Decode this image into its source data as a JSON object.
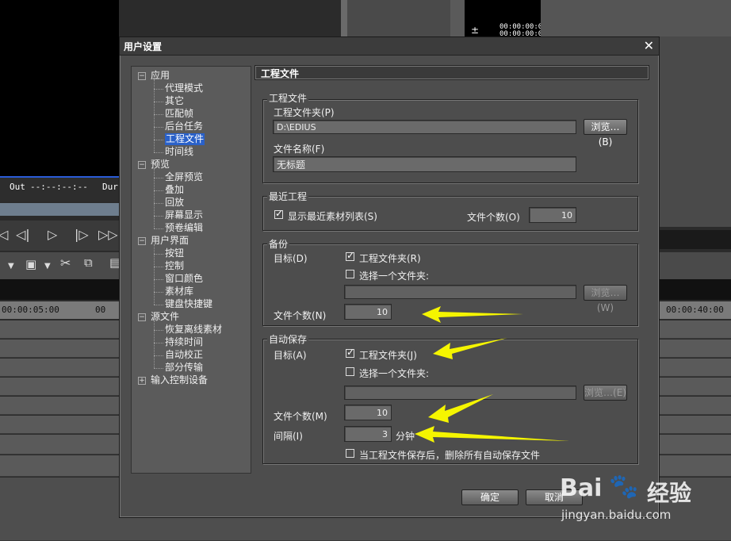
{
  "background": {
    "out_label": "Out",
    "out_tc": "--:--:--:--",
    "dur_label": "Dur",
    "tc_top1": "00:00:00:00",
    "tc_top2": "00:00:00:01",
    "ruler_left": "00:00:05:00",
    "ruler_mid": "00",
    "ruler_right": "00:00:40:00"
  },
  "dialog": {
    "title": "用户设置",
    "close_glyph": "✕",
    "tree": [
      {
        "label": "应用",
        "level": 0,
        "expander": "−"
      },
      {
        "label": "代理模式",
        "level": 1
      },
      {
        "label": "其它",
        "level": 1
      },
      {
        "label": "匹配帧",
        "level": 1
      },
      {
        "label": "后台任务",
        "level": 1
      },
      {
        "label": "工程文件",
        "level": 1,
        "selected": true
      },
      {
        "label": "时间线",
        "level": 1
      },
      {
        "label": "预览",
        "level": 0,
        "expander": "−"
      },
      {
        "label": "全屏预览",
        "level": 1
      },
      {
        "label": "叠加",
        "level": 1
      },
      {
        "label": "回放",
        "level": 1
      },
      {
        "label": "屏幕显示",
        "level": 1
      },
      {
        "label": "预卷编辑",
        "level": 1
      },
      {
        "label": "用户界面",
        "level": 0,
        "expander": "−"
      },
      {
        "label": "按钮",
        "level": 1
      },
      {
        "label": "控制",
        "level": 1
      },
      {
        "label": "窗口颜色",
        "level": 1
      },
      {
        "label": "素材库",
        "level": 1
      },
      {
        "label": "键盘快捷键",
        "level": 1
      },
      {
        "label": "源文件",
        "level": 0,
        "expander": "−"
      },
      {
        "label": "恢复离线素材",
        "level": 1
      },
      {
        "label": "持续时间",
        "level": 1
      },
      {
        "label": "自动校正",
        "level": 1
      },
      {
        "label": "部分传输",
        "level": 1
      },
      {
        "label": "输入控制设备",
        "level": 0,
        "expander": "+"
      }
    ],
    "panel_title": "工程文件",
    "project_file": {
      "group_label": "工程文件",
      "folder_label": "工程文件夹(P)",
      "folder_value": "D:\\EDIUS",
      "browse_label": "浏览…(B)",
      "name_label": "文件名称(F)",
      "name_value": "无标题"
    },
    "recent": {
      "group_label": "最近工程",
      "show_list_label": "显示最近素材列表(S)",
      "count_label": "文件个数(O)",
      "count_value": "10"
    },
    "backup": {
      "group_label": "备份",
      "target_label": "目标(D)",
      "opt_project_folder": "工程文件夹(R)",
      "opt_choose_folder": "选择一个文件夹:",
      "browse_label": "浏览…(W)",
      "count_label": "文件个数(N)",
      "count_value": "10"
    },
    "autosave": {
      "group_label": "自动保存",
      "target_label": "目标(A)",
      "opt_project_folder": "工程文件夹(J)",
      "opt_choose_folder": "选择一个文件夹:",
      "browse_label": "浏览…(E)",
      "count_label": "文件个数(M)",
      "count_value": "10",
      "interval_label": "间隔(I)",
      "interval_value": "3",
      "interval_unit": "分钟",
      "delete_label": "当工程文件保存后，删除所有自动保存文件"
    },
    "ok_label": "确定",
    "cancel_label": "取消"
  },
  "watermark": {
    "brand_left": "Bai",
    "brand_right": "经验",
    "url": "jingyan.baidu.com"
  },
  "colors": {
    "accent_arrow": "#f5f500",
    "selection": "#2a61c9",
    "preview_border": "#2a5bd7"
  }
}
